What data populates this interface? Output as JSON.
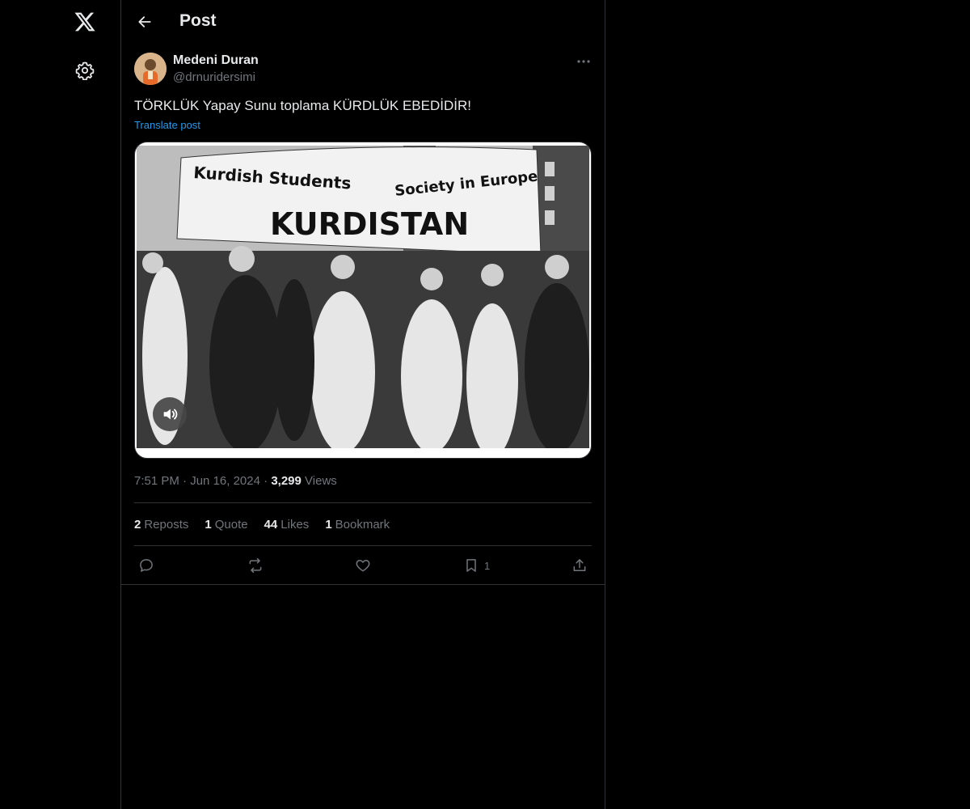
{
  "header": {
    "title": "Post"
  },
  "post": {
    "author_name": "Medeni Duran",
    "author_handle": "@drnuridersimi",
    "text": "TÖRKLÜK Yapay Sunu toplama KÜRDLÜK EBEDİDİR!",
    "translate_label": "Translate post",
    "media": {
      "banner_line1": "Kurdish Students",
      "banner_line2": "Society in Europe",
      "banner_main": "KURDISTAN"
    },
    "time": "7:51 PM",
    "date": "Jun 16, 2024",
    "views_count": "3,299",
    "views_label": "Views"
  },
  "stats": {
    "reposts_count": "2",
    "reposts_label": "Reposts",
    "quotes_count": "1",
    "quotes_label": "Quote",
    "likes_count": "44",
    "likes_label": "Likes",
    "bookmarks_count": "1",
    "bookmarks_label": "Bookmark"
  },
  "actions": {
    "bookmark_count": "1"
  },
  "icons": [
    "x-logo-icon",
    "gear-icon",
    "back-arrow-icon",
    "more-icon",
    "speaker-icon",
    "reply-icon",
    "repost-icon",
    "like-icon",
    "bookmark-icon",
    "share-icon"
  ],
  "colors": {
    "background": "#000000",
    "text": "#e7e9ea",
    "muted": "#71767b",
    "link": "#1d9bf0",
    "border": "#2f3336"
  }
}
